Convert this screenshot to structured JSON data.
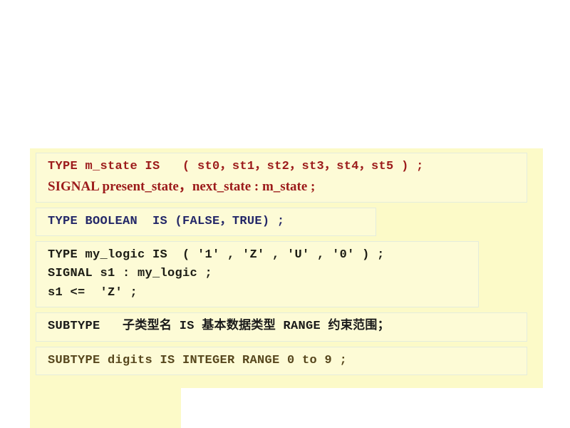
{
  "slide": {
    "background_color": "#ffffff",
    "panel_color": "#fcfac8",
    "box_color": "#fdfbd6",
    "box_border_color": "#e4ecdc"
  },
  "blocks": [
    {
      "id": "vhdl-enumerated-type-declaration",
      "text_color": "#9c1b1b",
      "lines": [
        {
          "text": "TYPE m_state IS   ( st0，st1，st2，st3，st4，st5 ) ;",
          "style": "mono"
        },
        {
          "text": "SIGNAL present_state，next_state : m_state ;",
          "style": "serif"
        }
      ]
    },
    {
      "id": "vhdl-boolean-type-declaration",
      "text_color": "#242868",
      "lines": [
        {
          "text": "TYPE BOOLEAN  IS (FALSE，TRUE) ;",
          "style": "mono"
        }
      ]
    },
    {
      "id": "vhdl-my-logic-type-declaration",
      "text_color": "#1c1c14",
      "lines": [
        {
          "text": "TYPE my_logic IS  ( '1' , 'Z' , 'U' , '0' ) ;",
          "style": "mono"
        },
        {
          "text": "SIGNAL s1 : my_logic ;",
          "style": "mono"
        },
        {
          "text": "s1 <=  'Z' ;",
          "style": "mono"
        }
      ]
    },
    {
      "id": "vhdl-subtype-syntax-template",
      "text_color": "#1a1a1a",
      "lines": [
        {
          "text": "SUBTYPE   子类型名 IS 基本数据类型 RANGE 约束范围；",
          "style": "mono"
        }
      ]
    },
    {
      "id": "vhdl-subtype-digits-example",
      "text_color": "#57471d",
      "lines": [
        {
          "text": "SUBTYPE digits IS INTEGER RANGE 0 to 9 ;",
          "style": "mono"
        }
      ]
    }
  ]
}
